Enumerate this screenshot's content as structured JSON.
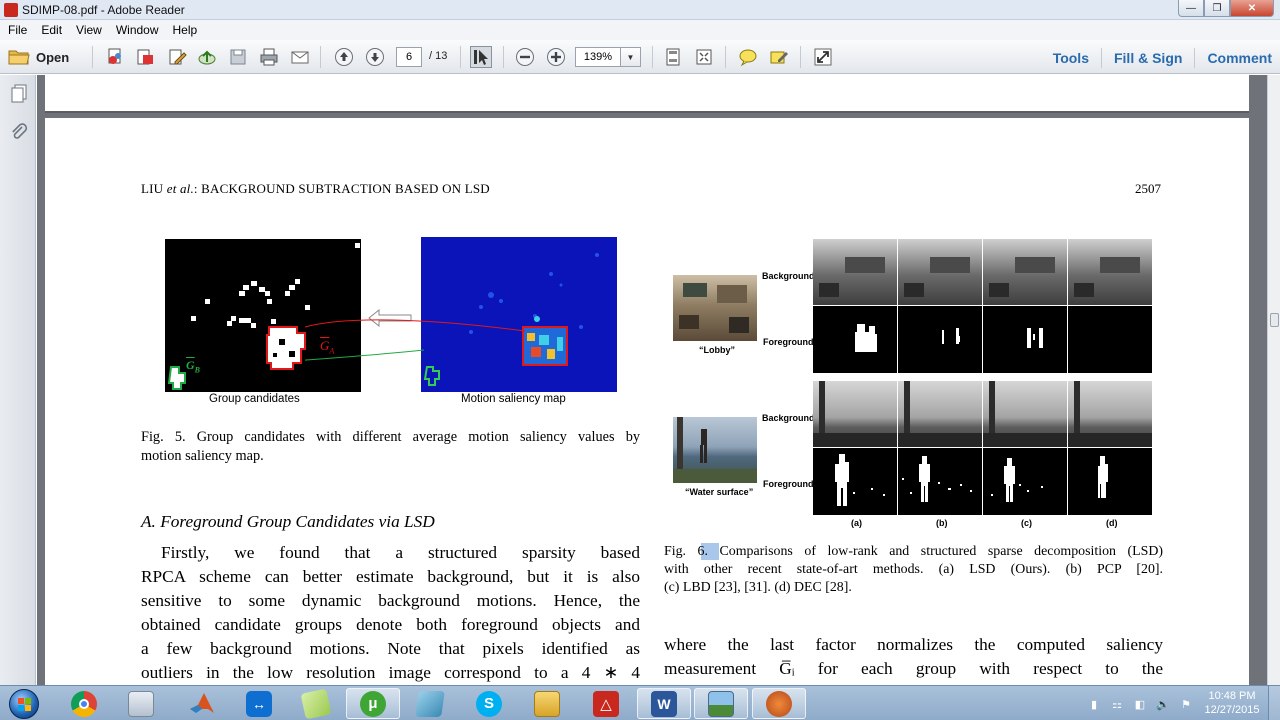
{
  "window": {
    "title": "SDIMP-08.pdf - Adobe Reader"
  },
  "menu": [
    "File",
    "Edit",
    "View",
    "Window",
    "Help"
  ],
  "toolbar": {
    "open_label": "Open",
    "page_current": "6",
    "page_total": "/ 13",
    "zoom": "139%",
    "tools_label": "Tools",
    "fill_sign_label": "Fill & Sign",
    "comment_label": "Comment"
  },
  "document": {
    "running_head_authors": "LIU",
    "running_head_etal": "et al.",
    "running_head_title": ": BACKGROUND SUBTRACTION BASED ON LSD",
    "page_number": "2507",
    "fig5": {
      "label_a": "Group candidates",
      "label_b": "Motion saliency map",
      "ga": "G",
      "ga_sub": "A",
      "gb": "G",
      "gb_sub": "B",
      "caption_lines": [
        "Fig. 5.   Group candidates with different average motion saliency values by",
        "motion saliency map."
      ]
    },
    "section_heading": "A. Foreground Group Candidates via LSD",
    "body_lines": [
      "Firstly, we found that a structured sparsity based",
      "RPCA scheme can better estimate background, but it is also",
      "sensitive to some dynamic background motions. Hence, the",
      "obtained candidate groups denote both foreground objects and",
      "a few background motions. Note that pixels identified as",
      "outliers in the low resolution image correspond to a 4 ∗ 4"
    ],
    "fig6": {
      "row_label_bg": "Background",
      "row_label_fg": "Foreground",
      "lobby": "“Lobby”",
      "water": "“Water surface”",
      "cols": [
        "(a)",
        "(b)",
        "(c)",
        "(d)"
      ],
      "caption_lines": [
        "Fig. 6.  Comparisons of low-rank and structured sparse decomposition (LSD)",
        "with other recent state-of-art methods. (a) LSD (Ours). (b) PCP [20].",
        "(c) LBD [23], [31]. (d) DEC [28]."
      ]
    },
    "right_body_lines": [
      "where the last factor normalizes the computed saliency",
      "measurement  G̅ᵢ  for each group with respect to the"
    ]
  },
  "taskbar": {
    "apps": [
      "chrome",
      "calculator",
      "matlab",
      "teamviewer",
      "notepad",
      "utorrent",
      "files",
      "skype",
      "explorer",
      "acrobat",
      "word",
      "paint",
      "pdf-viewer"
    ],
    "time": "10:48 PM",
    "date": "12/27/2015"
  },
  "colors": {
    "accent_link": "#2a6bb0",
    "titlebar": "#dfe8f3",
    "taskbar": "#9bb5d2",
    "doc_bg": "#6f7379",
    "saliency_blue": "#0b14b8"
  }
}
